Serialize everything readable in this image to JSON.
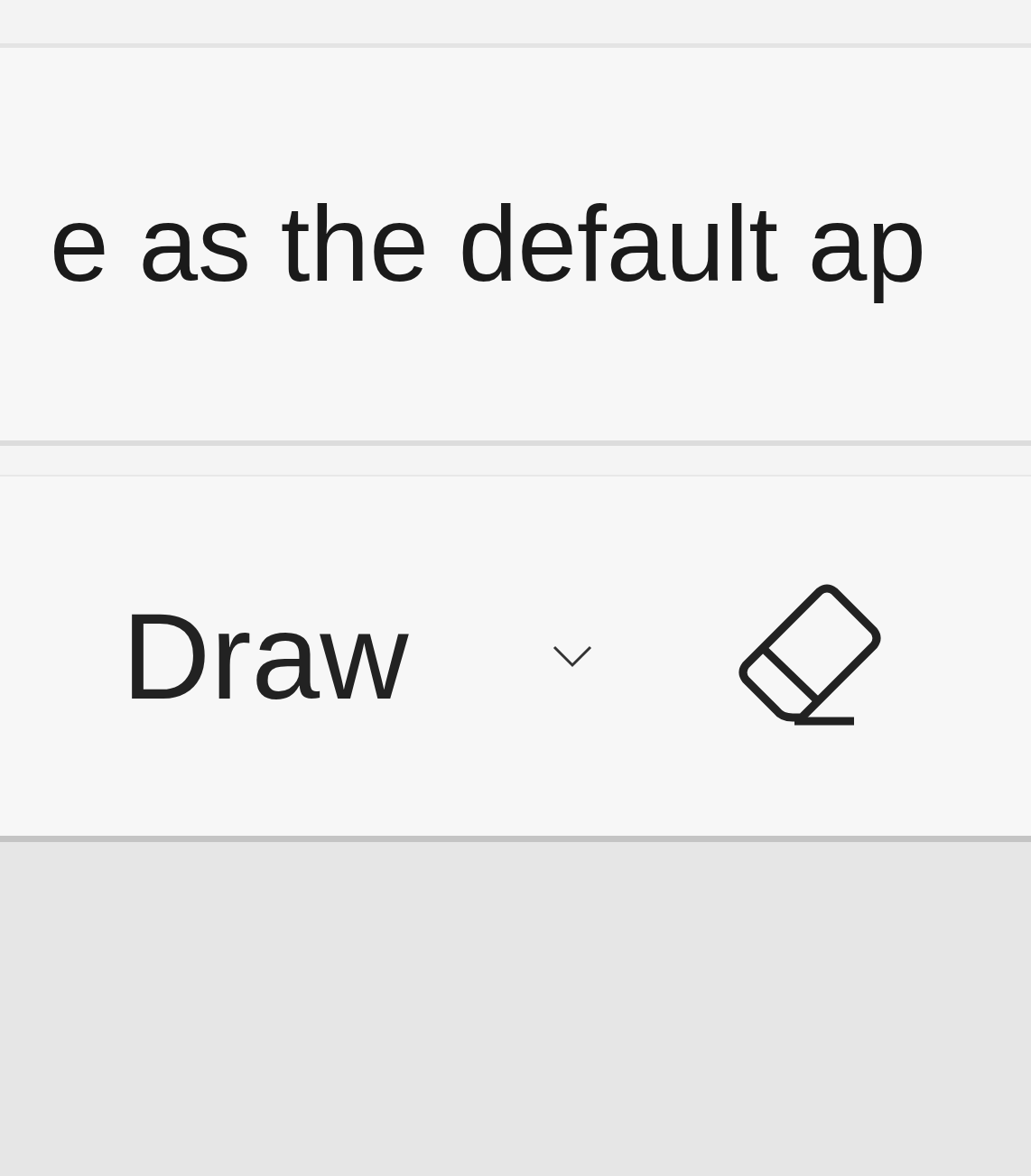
{
  "notification": {
    "text": "e as the default ap"
  },
  "toolbar": {
    "items": [
      {
        "kind": "dropdown",
        "label": "Draw"
      },
      {
        "kind": "eraser"
      }
    ]
  }
}
